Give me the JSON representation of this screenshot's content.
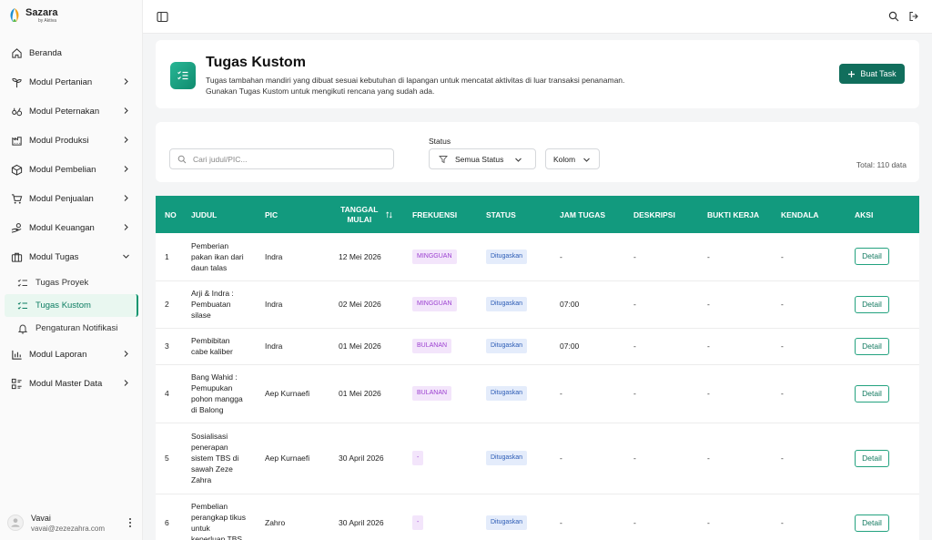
{
  "brand": {
    "name": "Sazara",
    "sub": "by Aktiva"
  },
  "sidebar": {
    "items": [
      {
        "label": "Beranda",
        "icon": "home-icon",
        "chevron": false
      },
      {
        "label": "Modul Pertanian",
        "icon": "sprout-icon",
        "chevron": true
      },
      {
        "label": "Modul Peternakan",
        "icon": "livestock-icon",
        "chevron": true
      },
      {
        "label": "Modul Produksi",
        "icon": "factory-icon",
        "chevron": true
      },
      {
        "label": "Modul Pembelian",
        "icon": "box-icon",
        "chevron": true
      },
      {
        "label": "Modul Penjualan",
        "icon": "cart-icon",
        "chevron": true
      },
      {
        "label": "Modul Keuangan",
        "icon": "hand-coins-icon",
        "chevron": true
      },
      {
        "label": "Modul Tugas",
        "icon": "briefcase-icon",
        "chevron": true,
        "expanded": true
      }
    ],
    "sub_items": [
      {
        "label": "Tugas Proyek",
        "icon": "list-check-icon"
      },
      {
        "label": "Tugas Kustom",
        "icon": "list-check-icon",
        "active": true
      },
      {
        "label": "Pengaturan Notifikasi",
        "icon": "bell-icon"
      }
    ],
    "items_after": [
      {
        "label": "Modul Laporan",
        "icon": "bar-chart-icon",
        "chevron": true
      },
      {
        "label": "Modul Master Data",
        "icon": "grid-list-icon",
        "chevron": true
      }
    ],
    "user": {
      "name": "Vavai",
      "email": "vavai@zezezahra.com"
    }
  },
  "header": {
    "title": "Tugas Kustom",
    "desc_line1": "Tugas tambahan mandiri yang dibuat sesuai kebutuhan di lapangan untuk mencatat aktivitas di luar transaksi penanaman.",
    "desc_line2": "Gunakan Tugas Kustom untuk mengikuti rencana yang sudah ada.",
    "button_label": "Buat Task"
  },
  "filters": {
    "search_placeholder": "Cari judul/PIC...",
    "status_label": "Status",
    "status_value": "Semua Status",
    "kolom_label": "Kolom",
    "total": "Total: 110 data"
  },
  "table": {
    "headers": [
      "NO",
      "JUDUL",
      "PIC",
      "TANGGAL MULAI",
      "FREKUENSI",
      "STATUS",
      "JAM TUGAS",
      "DESKRIPSI",
      "BUKTI KERJA",
      "KENDALA",
      "AKSI"
    ],
    "header_tanggal_1": "TANGGAL",
    "header_tanggal_2": "MULAI",
    "detail_label": "Detail",
    "rows": [
      {
        "no": "1",
        "judul": [
          "Pemberian",
          "pakan ikan dari",
          "daun talas"
        ],
        "pic": "Indra",
        "tanggal": "12 Mei 2026",
        "frekuensi": "MINGGUAN",
        "status": "Ditugaskan",
        "jam": "-",
        "deskripsi": "-",
        "bukti": "-",
        "kendala": "-"
      },
      {
        "no": "2",
        "judul": [
          "Arji & Indra :",
          "Pembuatan",
          "silase"
        ],
        "pic": "Indra",
        "tanggal": "02 Mei 2026",
        "frekuensi": "MINGGUAN",
        "status": "Ditugaskan",
        "jam": "07:00",
        "deskripsi": "-",
        "bukti": "-",
        "kendala": "-"
      },
      {
        "no": "3",
        "judul": [
          "Pembibitan",
          "cabe kaliber"
        ],
        "pic": "Indra",
        "tanggal": "01 Mei 2026",
        "frekuensi": "BULANAN",
        "status": "Ditugaskan",
        "jam": "07:00",
        "deskripsi": "-",
        "bukti": "-",
        "kendala": "-"
      },
      {
        "no": "4",
        "judul": [
          "Bang Wahid :",
          "Pemupukan",
          "pohon mangga",
          "di Balong"
        ],
        "pic": "Aep Kurnaefi",
        "tanggal": "01 Mei 2026",
        "frekuensi": "BULANAN",
        "status": "Ditugaskan",
        "jam": "-",
        "deskripsi": "-",
        "bukti": "-",
        "kendala": "-"
      },
      {
        "no": "5",
        "judul": [
          "Sosialisasi",
          "penerapan",
          "sistem TBS di",
          "sawah Zeze",
          "Zahra"
        ],
        "pic": "Aep Kurnaefi",
        "tanggal": "30 April 2026",
        "frekuensi": "-",
        "status": "Ditugaskan",
        "jam": "-",
        "deskripsi": "-",
        "bukti": "-",
        "kendala": "-"
      },
      {
        "no": "6",
        "judul": [
          "Pembelian",
          "perangkap tikus",
          "untuk",
          "keperluan TBS"
        ],
        "pic": "Zahro",
        "tanggal": "30 April 2026",
        "frekuensi": "-",
        "status": "Ditugaskan",
        "jam": "-",
        "deskripsi": "-",
        "bukti": "-",
        "kendala": "-"
      }
    ]
  },
  "colors": {
    "primary": "#129a7e",
    "button": "#116e5c",
    "purple_badge": "#9b3fd0",
    "blue_badge": "#2b5bb5"
  }
}
